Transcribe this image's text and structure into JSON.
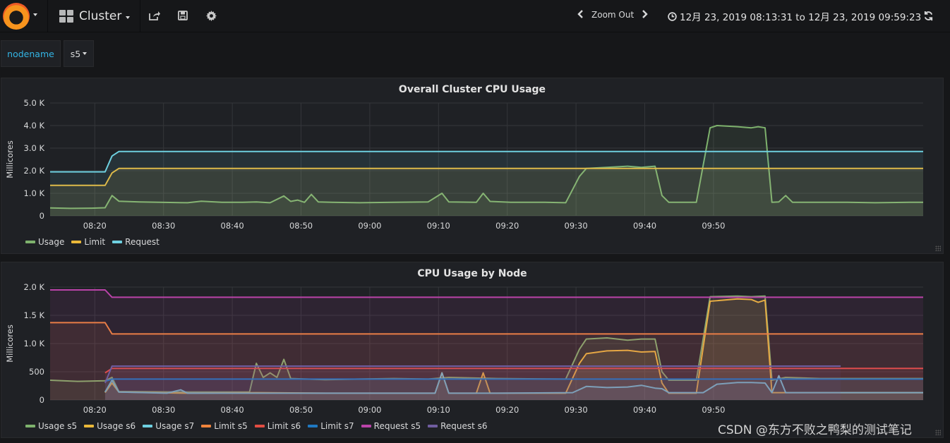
{
  "topbar": {
    "dashboard_title": "Cluster",
    "zoom_label": "Zoom Out",
    "time_range": "12月 23, 2019 08:13:31 to 12月 23, 2019 09:59:23"
  },
  "variables": {
    "label": "nodename",
    "value": "s5"
  },
  "colors": {
    "background": "#161719",
    "panel": "#1f2125",
    "usage": "#7eb26d",
    "limit": "#eab839",
    "request": "#6ed0e0",
    "usage_s5": "#7eb26d",
    "usage_s6": "#eab839",
    "usage_s7": "#6ed0e0",
    "limit_s5": "#ef843c",
    "limit_s6": "#e24d42",
    "limit_s7": "#1f78c1",
    "request_s5": "#ba43a9",
    "request_s6": "#705da0"
  },
  "panels": {
    "overall": {
      "title": "Overall Cluster CPU Usage",
      "ylabel": "Millicores",
      "yticks": [
        "5.0 K",
        "4.0 K",
        "3.0 K",
        "2.0 K",
        "1.0 K",
        "0"
      ],
      "xticks": [
        "08:20",
        "08:30",
        "08:40",
        "08:50",
        "09:00",
        "09:10",
        "09:20",
        "09:30",
        "09:40",
        "09:50"
      ],
      "legend": [
        "Usage",
        "Limit",
        "Request"
      ]
    },
    "by_node": {
      "title": "CPU Usage by Node",
      "ylabel": "Millicores",
      "yticks": [
        "2.0 K",
        "1.5 K",
        "1.0 K",
        "500",
        "0"
      ],
      "xticks": [
        "08:20",
        "08:30",
        "08:40",
        "08:50",
        "09:00",
        "09:10",
        "09:20",
        "09:30",
        "09:40",
        "09:50"
      ],
      "legend": [
        "Usage s5",
        "Usage s6",
        "Usage s7",
        "Limit s5",
        "Limit s6",
        "Limit s7",
        "Request s5",
        "Request s6"
      ]
    }
  },
  "chart_data": [
    {
      "type": "line",
      "title": "Overall Cluster CPU Usage",
      "ylabel": "Millicores",
      "ylim": [
        0,
        5000
      ],
      "x_range": [
        "08:13:31",
        "09:59:23"
      ],
      "legend_placement": "bottom-left",
      "grid": true,
      "series": [
        {
          "name": "Usage",
          "points": [
            [
              0,
              350
            ],
            [
              3,
              330
            ],
            [
              6,
              340
            ],
            [
              8,
              360
            ],
            [
              9,
              900
            ],
            [
              10,
              650
            ],
            [
              13,
              620
            ],
            [
              16,
              600
            ],
            [
              20,
              580
            ],
            [
              22,
              650
            ],
            [
              25,
              600
            ],
            [
              28,
              600
            ],
            [
              30,
              620
            ],
            [
              32,
              580
            ],
            [
              34,
              880
            ],
            [
              35,
              640
            ],
            [
              36,
              700
            ],
            [
              37,
              600
            ],
            [
              38,
              950
            ],
            [
              39,
              620
            ],
            [
              41,
              600
            ],
            [
              45,
              580
            ],
            [
              50,
              600
            ],
            [
              55,
              620
            ],
            [
              57,
              1000
            ],
            [
              58,
              620
            ],
            [
              62,
              600
            ],
            [
              63,
              1000
            ],
            [
              64,
              640
            ],
            [
              67,
              600
            ],
            [
              72,
              600
            ],
            [
              75,
              580
            ],
            [
              77,
              1750
            ],
            [
              78,
              2100
            ],
            [
              81,
              2150
            ],
            [
              84,
              2200
            ],
            [
              86,
              2150
            ],
            [
              88,
              2200
            ],
            [
              89,
              900
            ],
            [
              90,
              600
            ],
            [
              93,
              600
            ],
            [
              94,
              600
            ],
            [
              96,
              3900
            ],
            [
              97,
              4000
            ],
            [
              100,
              3950
            ],
            [
              102,
              3900
            ],
            [
              103,
              3950
            ],
            [
              104,
              3900
            ],
            [
              105,
              600
            ],
            [
              106,
              620
            ],
            [
              107,
              900
            ],
            [
              108,
              600
            ],
            [
              112,
              600
            ],
            [
              116,
              600
            ],
            [
              120,
              580
            ],
            [
              125,
              600
            ],
            [
              127,
              600
            ]
          ]
        },
        {
          "name": "Limit",
          "points": [
            [
              0,
              1350
            ],
            [
              8,
              1350
            ],
            [
              9,
              1900
            ],
            [
              10,
              2100
            ],
            [
              127,
              2100
            ]
          ]
        },
        {
          "name": "Request",
          "points": [
            [
              0,
              1950
            ],
            [
              8,
              1950
            ],
            [
              9,
              2650
            ],
            [
              10,
              2850
            ],
            [
              127,
              2850
            ]
          ]
        }
      ]
    },
    {
      "type": "line",
      "title": "CPU Usage by Node",
      "ylabel": "Millicores",
      "ylim": [
        0,
        2000
      ],
      "x_range": [
        "08:13:31",
        "09:59:23"
      ],
      "legend_placement": "bottom-left",
      "grid": true,
      "series": [
        {
          "name": "Usage s5",
          "points": [
            [
              0,
              350
            ],
            [
              4,
              330
            ],
            [
              8,
              340
            ],
            [
              9,
              400
            ],
            [
              10,
              150
            ],
            [
              20,
              140
            ],
            [
              29,
              140
            ],
            [
              30,
              650
            ],
            [
              31,
              400
            ],
            [
              32,
              480
            ],
            [
              33,
              400
            ],
            [
              34,
              720
            ],
            [
              35,
              380
            ],
            [
              40,
              360
            ],
            [
              50,
              380
            ],
            [
              55,
              370
            ],
            [
              58,
              400
            ],
            [
              65,
              380
            ],
            [
              75,
              370
            ],
            [
              77,
              900
            ],
            [
              78,
              1080
            ],
            [
              81,
              1100
            ],
            [
              84,
              1060
            ],
            [
              86,
              1080
            ],
            [
              88,
              1080
            ],
            [
              89,
              500
            ],
            [
              90,
              350
            ],
            [
              94,
              350
            ],
            [
              96,
              1830
            ],
            [
              100,
              1840
            ],
            [
              102,
              1830
            ],
            [
              104,
              1840
            ],
            [
              105,
              350
            ],
            [
              107,
              400
            ],
            [
              112,
              380
            ],
            [
              127,
              380
            ]
          ]
        },
        {
          "name": "Usage s6",
          "points": [
            [
              8,
              130
            ],
            [
              9,
              300
            ],
            [
              10,
              140
            ],
            [
              20,
              120
            ],
            [
              30,
              130
            ],
            [
              40,
              120
            ],
            [
              45,
              120
            ],
            [
              50,
              120
            ],
            [
              56,
              120
            ],
            [
              57,
              480
            ],
            [
              58,
              120
            ],
            [
              62,
              120
            ],
            [
              63,
              480
            ],
            [
              64,
              120
            ],
            [
              75,
              120
            ],
            [
              77,
              650
            ],
            [
              78,
              820
            ],
            [
              81,
              870
            ],
            [
              84,
              880
            ],
            [
              86,
              850
            ],
            [
              88,
              860
            ],
            [
              89,
              300
            ],
            [
              90,
              120
            ],
            [
              94,
              120
            ],
            [
              96,
              1750
            ],
            [
              100,
              1790
            ],
            [
              102,
              1780
            ],
            [
              103,
              1730
            ],
            [
              104,
              1770
            ],
            [
              105,
              130
            ],
            [
              107,
              130
            ],
            [
              127,
              130
            ]
          ]
        },
        {
          "name": "Usage s7",
          "points": [
            [
              8,
              140
            ],
            [
              9,
              350
            ],
            [
              10,
              140
            ],
            [
              17,
              120
            ],
            [
              19,
              180
            ],
            [
              20,
              120
            ],
            [
              30,
              120
            ],
            [
              40,
              120
            ],
            [
              50,
              120
            ],
            [
              56,
              120
            ],
            [
              57,
              480
            ],
            [
              58,
              120
            ],
            [
              65,
              120
            ],
            [
              76,
              130
            ],
            [
              78,
              240
            ],
            [
              81,
              220
            ],
            [
              84,
              230
            ],
            [
              86,
              260
            ],
            [
              88,
              210
            ],
            [
              89,
              200
            ],
            [
              90,
              130
            ],
            [
              95,
              130
            ],
            [
              97,
              280
            ],
            [
              100,
              310
            ],
            [
              102,
              310
            ],
            [
              104,
              300
            ],
            [
              105,
              130
            ],
            [
              106,
              430
            ],
            [
              107,
              130
            ],
            [
              127,
              130
            ]
          ]
        },
        {
          "name": "Limit s5",
          "points": [
            [
              0,
              1370
            ],
            [
              8,
              1370
            ],
            [
              9,
              1170
            ],
            [
              127,
              1170
            ]
          ]
        },
        {
          "name": "Limit s6",
          "points": [
            [
              8,
              480
            ],
            [
              9,
              560
            ],
            [
              127,
              560
            ]
          ]
        },
        {
          "name": "Limit s7",
          "points": [
            [
              8,
              330
            ],
            [
              9,
              370
            ],
            [
              127,
              370
            ]
          ]
        },
        {
          "name": "Request s5",
          "points": [
            [
              0,
              1950
            ],
            [
              8,
              1950
            ],
            [
              9,
              1820
            ],
            [
              127,
              1820
            ]
          ]
        },
        {
          "name": "Request s6",
          "points": [
            [
              8,
              300
            ],
            [
              9,
              600
            ],
            [
              115,
              600
            ]
          ]
        }
      ]
    }
  ],
  "watermark": "CSDN @东方不败之鸭梨的测试笔记"
}
